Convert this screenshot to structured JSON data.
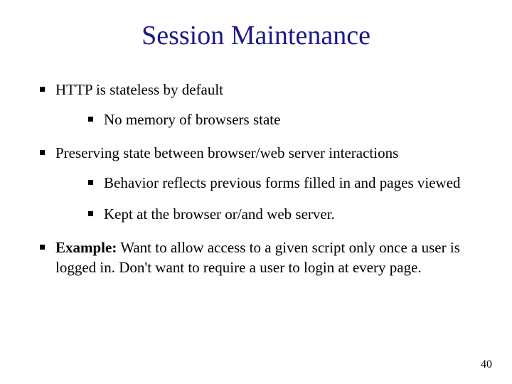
{
  "title": "Session Maintenance",
  "bullets": {
    "b0": {
      "text": "HTTP is stateless by default",
      "sub": {
        "s0": "No memory of browsers state"
      }
    },
    "b1": {
      "text": "Preserving state between browser/web server interactions",
      "sub": {
        "s0": "Behavior reflects previous forms filled in and pages viewed",
        "s1": "Kept at the browser or/and web server."
      }
    },
    "b2": {
      "lead": "Example:",
      "rest": " Want to allow access to a given script only once a user is logged in. Don't want to require a user to login at every page."
    }
  },
  "page_number": "40"
}
